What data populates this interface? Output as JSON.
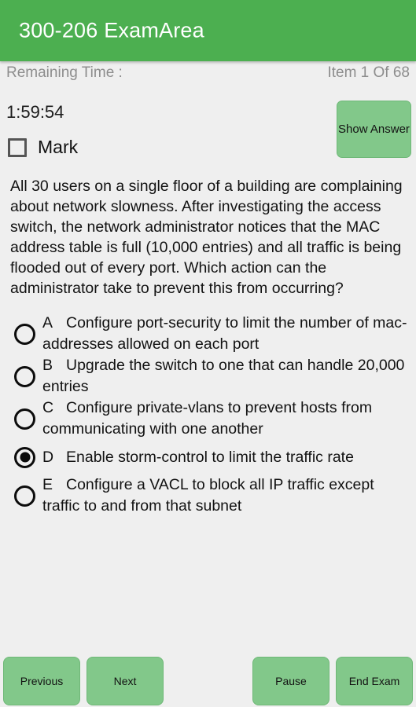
{
  "app_bar": {
    "title": "300-206 ExamArea",
    "background_color": "#4CAF50",
    "title_color": "#FFFFFF"
  },
  "status": {
    "remaining_time_label": "Remaining Time :",
    "item_counter": "Item 1 Of 68",
    "current_item": 1,
    "total_items": 68
  },
  "timer": {
    "value": "1:59:54"
  },
  "mark": {
    "label": "Mark",
    "checked": false
  },
  "show_answer": {
    "label": "Show Answer"
  },
  "question": {
    "text": "All 30 users on a single floor of a building are complaining about network slowness. After investigating the access switch, the network administrator notices that the MAC address table is full (10,000 entries) and all traffic is being flooded out of every port. Which action can the administrator take to prevent this from occurring?"
  },
  "options": [
    {
      "letter": "A",
      "text": "Configure port-security to limit the number of mac-addresses allowed on each port",
      "selected": false
    },
    {
      "letter": "B",
      "text": "Upgrade the switch to one that can handle 20,000 entries",
      "selected": false
    },
    {
      "letter": "C",
      "text": "Configure private-vlans to prevent hosts from communicating with one another",
      "selected": false
    },
    {
      "letter": "D",
      "text": "Enable storm-control to limit the traffic rate",
      "selected": true
    },
    {
      "letter": "E",
      "text": "Configure a VACL to block all IP traffic except traffic to and from that subnet",
      "selected": false
    }
  ],
  "bottom_bar": {
    "previous_label": "Previous",
    "next_label": "Next",
    "pause_label": "Pause",
    "end_exam_label": "End Exam",
    "button_color": "#82C88A"
  },
  "page": {
    "background_color": "#EFEFEF"
  }
}
